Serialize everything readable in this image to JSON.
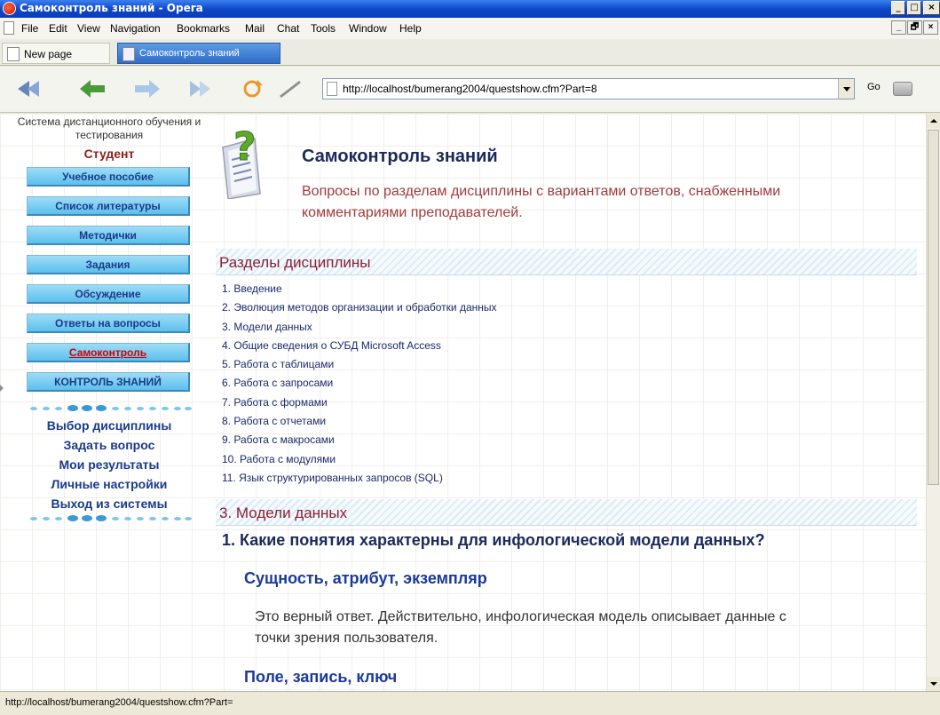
{
  "window": {
    "title": "Самоконтроль знаний - Opera",
    "controls": {
      "minimize": "_",
      "maximize": "□",
      "close": "×",
      "mdi_minimize": "_",
      "mdi_restore": "🗗",
      "mdi_close": "×"
    }
  },
  "menu": [
    "File",
    "Edit",
    "View",
    "Navigation",
    "Bookmarks",
    "Mail",
    "Chat",
    "Tools",
    "Window",
    "Help"
  ],
  "tabs": [
    {
      "label": "New page",
      "active": false
    },
    {
      "label": "Самоконтроль знаний",
      "active": true
    }
  ],
  "toolbar": {
    "icons": [
      "rewind-icon",
      "back-icon",
      "forward-icon",
      "fast-forward-icon",
      "reload-icon",
      "edit-icon"
    ],
    "address": "http://localhost/bumerang2004/questshow.cfm?Part=8",
    "go_label": "Go"
  },
  "sidebar": {
    "system_name": "Система дистанционного обучения и тестирования",
    "role": "Студент",
    "menu_buttons": [
      {
        "label": "Учебное пособие"
      },
      {
        "label": "Список литературы"
      },
      {
        "label": "Методички"
      },
      {
        "label": "Задания"
      },
      {
        "label": "Обсуждение"
      },
      {
        "label": "Ответы на вопросы"
      },
      {
        "label": "Самоконтроль",
        "active": true
      },
      {
        "label": "КОНТРОЛЬ ЗНАНИЙ"
      }
    ],
    "links": [
      "Выбор дисциплины",
      "Задать вопрос",
      "Мои результаты",
      "Личные настройки",
      "Выход из системы"
    ]
  },
  "main": {
    "title": "Самоконтроль знаний",
    "subtitle": "Вопросы по разделам дисциплины с вариантами ответов, снабженными комментариями преподавателей.",
    "sections_heading": "Разделы дисциплины",
    "sections": [
      "1. Введение",
      "2. Эволюция методов организации и обработки данных",
      "3. Модели данных",
      "4. Общие сведения о СУБД Microsoft Access",
      "5. Работа с таблицами",
      "6. Работа с запросами",
      "7. Работа с формами",
      "8. Работа с отчетами",
      "9. Работа с макросами",
      "10. Работа с модулями",
      "11. Язык структурированных запросов (SQL)"
    ],
    "current_section": "3. Модели данных",
    "question": "1. Какие понятия характерны для инфологической модели данных?",
    "answers": [
      {
        "text": "Сущность, атрибут, экземпляр",
        "comment": "Это верный ответ. Действительно, инфологическая модель описывает данные с точки зрения пользователя."
      },
      {
        "text": "Поле, запись, ключ"
      }
    ]
  },
  "status_bar": "http://localhost/bumerang2004/questshow.cfm?Part=",
  "colors": {
    "titlebar": "#1048c8",
    "sidebar_button": "#5cc0ee",
    "section_heading": "#8b2030",
    "link": "#1a2a6a",
    "active_menu": "#d00000"
  }
}
